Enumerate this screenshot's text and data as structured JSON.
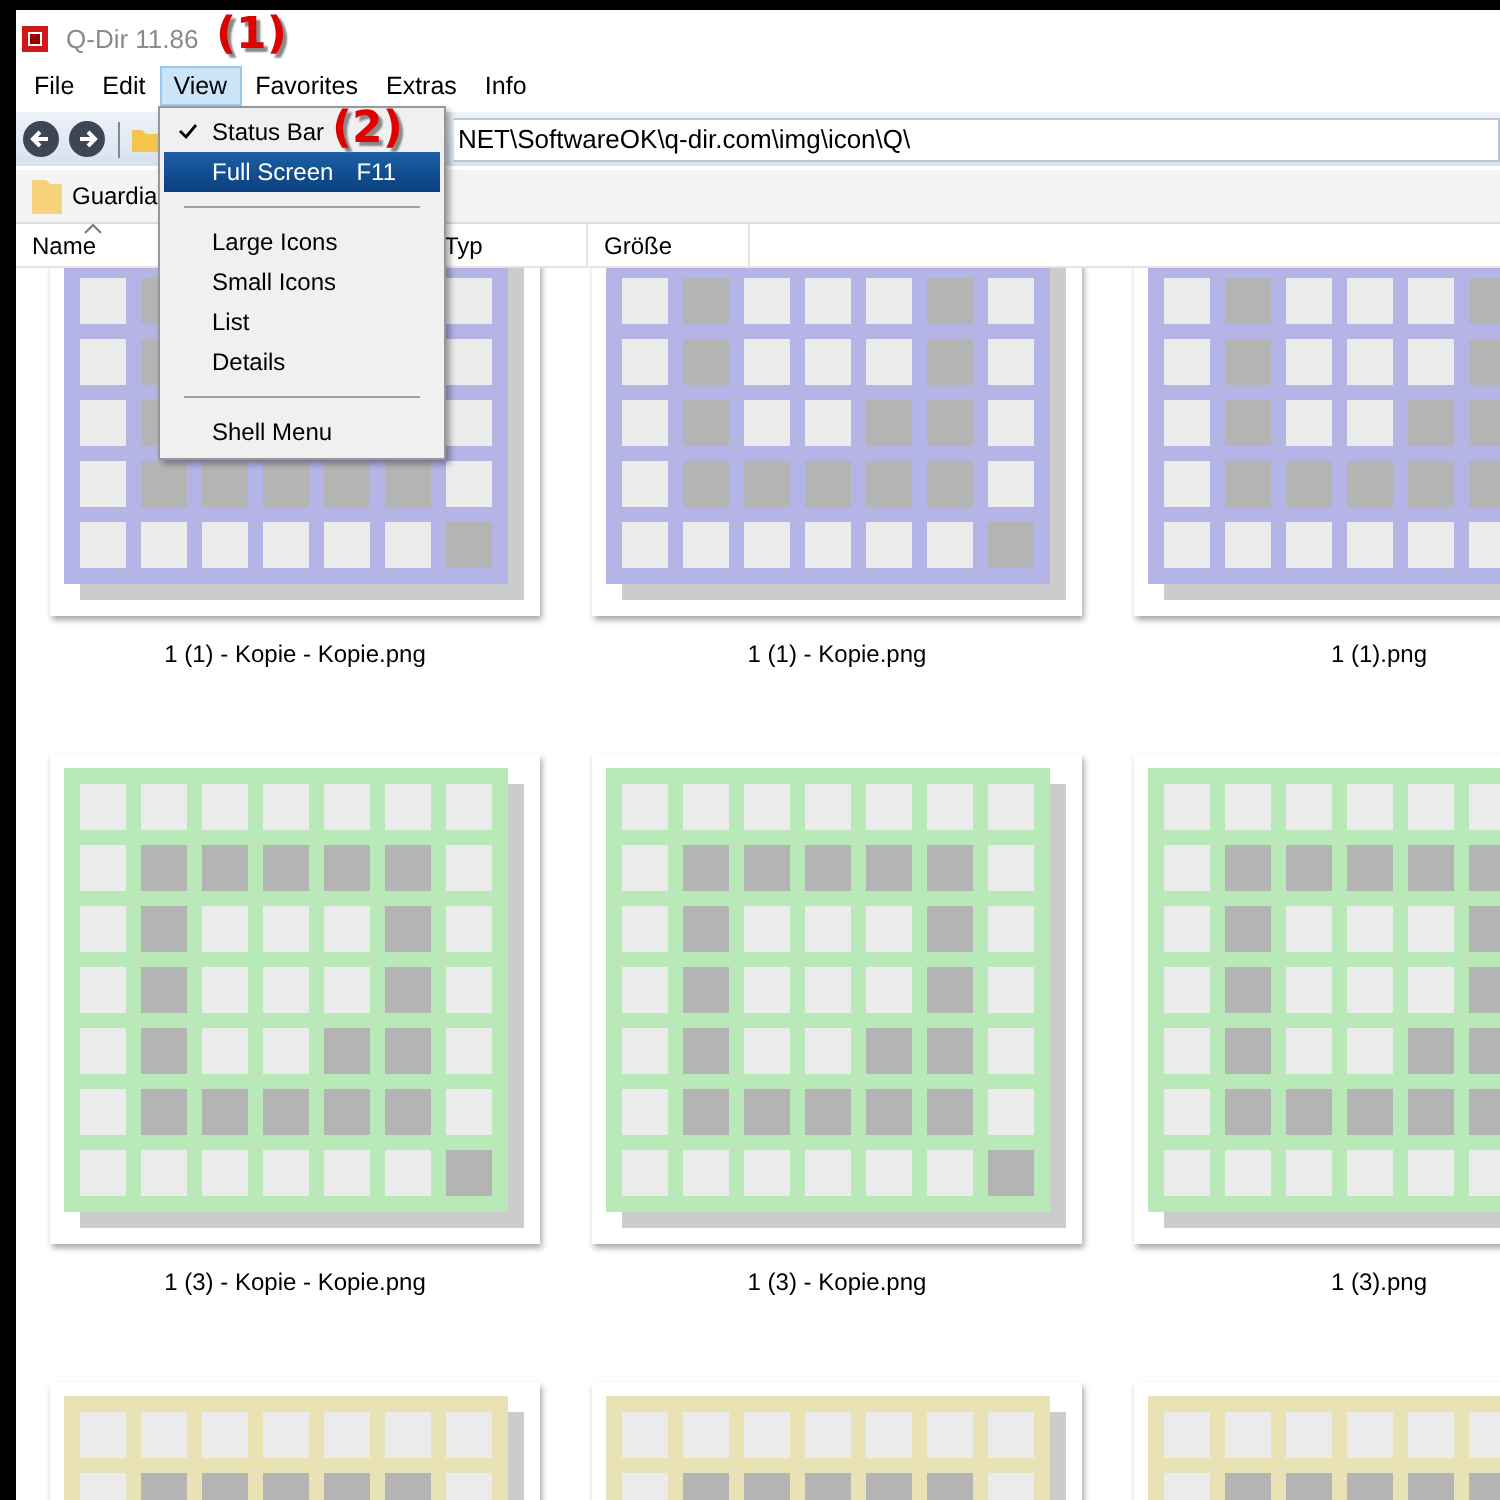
{
  "window": {
    "title": "Q-Dir 11.86"
  },
  "menu_bar": [
    {
      "label": "File",
      "selected": false
    },
    {
      "label": "Edit",
      "selected": false
    },
    {
      "label": "View",
      "selected": true
    },
    {
      "label": "Favorites",
      "selected": false
    },
    {
      "label": "Extras",
      "selected": false
    },
    {
      "label": "Info",
      "selected": false
    }
  ],
  "address_bar": {
    "value": "NET\\SoftwareOK\\q-dir.com\\img\\icon\\Q\\"
  },
  "favorites_bar": [
    {
      "label": "Guardia"
    }
  ],
  "columns": [
    {
      "label": "Name",
      "sorted": true
    },
    {
      "label": "Typ",
      "sorted": false
    },
    {
      "label": "Größe",
      "sorted": false
    }
  ],
  "view_menu": {
    "items": [
      {
        "kind": "item",
        "label": "Status Bar",
        "checked": true,
        "selected": false
      },
      {
        "kind": "item",
        "label": "Full Screen",
        "shortcut": "F11",
        "checked": false,
        "selected": true
      },
      {
        "kind": "separator"
      },
      {
        "kind": "item",
        "label": "Large Icons",
        "checked": false,
        "selected": false
      },
      {
        "kind": "item",
        "label": "Small Icons",
        "checked": false,
        "selected": false
      },
      {
        "kind": "item",
        "label": "List",
        "checked": false,
        "selected": false
      },
      {
        "kind": "item",
        "label": "Details",
        "checked": false,
        "selected": false
      },
      {
        "kind": "separator"
      },
      {
        "kind": "item",
        "label": "Shell Menu",
        "checked": false,
        "selected": false
      }
    ]
  },
  "files": [
    {
      "name": "1 (1) - Kopie - Kopie.png",
      "color": "#b4b4e6"
    },
    {
      "name": "1 (1) - Kopie.png",
      "color": "#b4b4e6"
    },
    {
      "name": "1 (1).png",
      "color": "#b4b4e6"
    },
    {
      "name": "1 (3) - Kopie - Kopie.png",
      "color": "#b9e8b9"
    },
    {
      "name": "1 (3) - Kopie.png",
      "color": "#b9e8b9"
    },
    {
      "name": "1 (3).png",
      "color": "#b9e8b9"
    },
    {
      "color": "#e8e2b4"
    },
    {
      "color": "#e8e2b4"
    },
    {
      "color": "#e8e2b4"
    }
  ],
  "annotations": [
    "(1)",
    "(2)"
  ]
}
